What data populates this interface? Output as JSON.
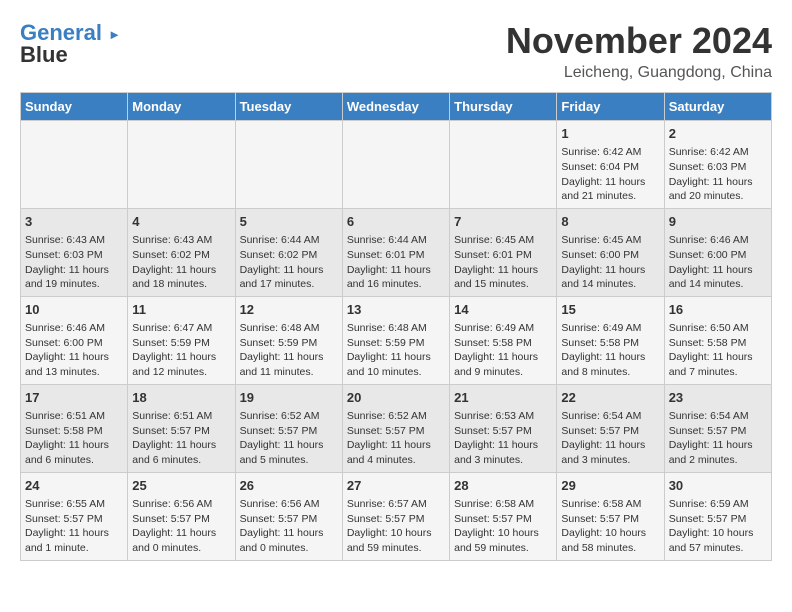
{
  "header": {
    "logo_line1": "General",
    "logo_line2": "Blue",
    "month": "November 2024",
    "location": "Leicheng, Guangdong, China"
  },
  "days_of_week": [
    "Sunday",
    "Monday",
    "Tuesday",
    "Wednesday",
    "Thursday",
    "Friday",
    "Saturday"
  ],
  "weeks": [
    [
      {
        "day": "",
        "sunrise": "",
        "sunset": "",
        "daylight": ""
      },
      {
        "day": "",
        "sunrise": "",
        "sunset": "",
        "daylight": ""
      },
      {
        "day": "",
        "sunrise": "",
        "sunset": "",
        "daylight": ""
      },
      {
        "day": "",
        "sunrise": "",
        "sunset": "",
        "daylight": ""
      },
      {
        "day": "",
        "sunrise": "",
        "sunset": "",
        "daylight": ""
      },
      {
        "day": "1",
        "sunrise": "Sunrise: 6:42 AM",
        "sunset": "Sunset: 6:04 PM",
        "daylight": "Daylight: 11 hours and 21 minutes."
      },
      {
        "day": "2",
        "sunrise": "Sunrise: 6:42 AM",
        "sunset": "Sunset: 6:03 PM",
        "daylight": "Daylight: 11 hours and 20 minutes."
      }
    ],
    [
      {
        "day": "3",
        "sunrise": "Sunrise: 6:43 AM",
        "sunset": "Sunset: 6:03 PM",
        "daylight": "Daylight: 11 hours and 19 minutes."
      },
      {
        "day": "4",
        "sunrise": "Sunrise: 6:43 AM",
        "sunset": "Sunset: 6:02 PM",
        "daylight": "Daylight: 11 hours and 18 minutes."
      },
      {
        "day": "5",
        "sunrise": "Sunrise: 6:44 AM",
        "sunset": "Sunset: 6:02 PM",
        "daylight": "Daylight: 11 hours and 17 minutes."
      },
      {
        "day": "6",
        "sunrise": "Sunrise: 6:44 AM",
        "sunset": "Sunset: 6:01 PM",
        "daylight": "Daylight: 11 hours and 16 minutes."
      },
      {
        "day": "7",
        "sunrise": "Sunrise: 6:45 AM",
        "sunset": "Sunset: 6:01 PM",
        "daylight": "Daylight: 11 hours and 15 minutes."
      },
      {
        "day": "8",
        "sunrise": "Sunrise: 6:45 AM",
        "sunset": "Sunset: 6:00 PM",
        "daylight": "Daylight: 11 hours and 14 minutes."
      },
      {
        "day": "9",
        "sunrise": "Sunrise: 6:46 AM",
        "sunset": "Sunset: 6:00 PM",
        "daylight": "Daylight: 11 hours and 14 minutes."
      }
    ],
    [
      {
        "day": "10",
        "sunrise": "Sunrise: 6:46 AM",
        "sunset": "Sunset: 6:00 PM",
        "daylight": "Daylight: 11 hours and 13 minutes."
      },
      {
        "day": "11",
        "sunrise": "Sunrise: 6:47 AM",
        "sunset": "Sunset: 5:59 PM",
        "daylight": "Daylight: 11 hours and 12 minutes."
      },
      {
        "day": "12",
        "sunrise": "Sunrise: 6:48 AM",
        "sunset": "Sunset: 5:59 PM",
        "daylight": "Daylight: 11 hours and 11 minutes."
      },
      {
        "day": "13",
        "sunrise": "Sunrise: 6:48 AM",
        "sunset": "Sunset: 5:59 PM",
        "daylight": "Daylight: 11 hours and 10 minutes."
      },
      {
        "day": "14",
        "sunrise": "Sunrise: 6:49 AM",
        "sunset": "Sunset: 5:58 PM",
        "daylight": "Daylight: 11 hours and 9 minutes."
      },
      {
        "day": "15",
        "sunrise": "Sunrise: 6:49 AM",
        "sunset": "Sunset: 5:58 PM",
        "daylight": "Daylight: 11 hours and 8 minutes."
      },
      {
        "day": "16",
        "sunrise": "Sunrise: 6:50 AM",
        "sunset": "Sunset: 5:58 PM",
        "daylight": "Daylight: 11 hours and 7 minutes."
      }
    ],
    [
      {
        "day": "17",
        "sunrise": "Sunrise: 6:51 AM",
        "sunset": "Sunset: 5:58 PM",
        "daylight": "Daylight: 11 hours and 6 minutes."
      },
      {
        "day": "18",
        "sunrise": "Sunrise: 6:51 AM",
        "sunset": "Sunset: 5:57 PM",
        "daylight": "Daylight: 11 hours and 6 minutes."
      },
      {
        "day": "19",
        "sunrise": "Sunrise: 6:52 AM",
        "sunset": "Sunset: 5:57 PM",
        "daylight": "Daylight: 11 hours and 5 minutes."
      },
      {
        "day": "20",
        "sunrise": "Sunrise: 6:52 AM",
        "sunset": "Sunset: 5:57 PM",
        "daylight": "Daylight: 11 hours and 4 minutes."
      },
      {
        "day": "21",
        "sunrise": "Sunrise: 6:53 AM",
        "sunset": "Sunset: 5:57 PM",
        "daylight": "Daylight: 11 hours and 3 minutes."
      },
      {
        "day": "22",
        "sunrise": "Sunrise: 6:54 AM",
        "sunset": "Sunset: 5:57 PM",
        "daylight": "Daylight: 11 hours and 3 minutes."
      },
      {
        "day": "23",
        "sunrise": "Sunrise: 6:54 AM",
        "sunset": "Sunset: 5:57 PM",
        "daylight": "Daylight: 11 hours and 2 minutes."
      }
    ],
    [
      {
        "day": "24",
        "sunrise": "Sunrise: 6:55 AM",
        "sunset": "Sunset: 5:57 PM",
        "daylight": "Daylight: 11 hours and 1 minute."
      },
      {
        "day": "25",
        "sunrise": "Sunrise: 6:56 AM",
        "sunset": "Sunset: 5:57 PM",
        "daylight": "Daylight: 11 hours and 0 minutes."
      },
      {
        "day": "26",
        "sunrise": "Sunrise: 6:56 AM",
        "sunset": "Sunset: 5:57 PM",
        "daylight": "Daylight: 11 hours and 0 minutes."
      },
      {
        "day": "27",
        "sunrise": "Sunrise: 6:57 AM",
        "sunset": "Sunset: 5:57 PM",
        "daylight": "Daylight: 10 hours and 59 minutes."
      },
      {
        "day": "28",
        "sunrise": "Sunrise: 6:58 AM",
        "sunset": "Sunset: 5:57 PM",
        "daylight": "Daylight: 10 hours and 59 minutes."
      },
      {
        "day": "29",
        "sunrise": "Sunrise: 6:58 AM",
        "sunset": "Sunset: 5:57 PM",
        "daylight": "Daylight: 10 hours and 58 minutes."
      },
      {
        "day": "30",
        "sunrise": "Sunrise: 6:59 AM",
        "sunset": "Sunset: 5:57 PM",
        "daylight": "Daylight: 10 hours and 57 minutes."
      }
    ]
  ]
}
